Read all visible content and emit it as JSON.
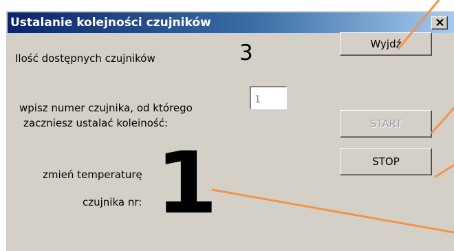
{
  "window": {
    "title": "Ustalanie kolejności czujników",
    "close_symbol": "×"
  },
  "info": {
    "available_label": "Ilość dostępnych czujników",
    "available_count": "3"
  },
  "start_sensor": {
    "label_line1": "wpisz numer czujnika, od którego",
    "label_line2": "zaczniesz ustalać koleiność:",
    "input_value": "1"
  },
  "change_temp": {
    "label_line1": "zmień temperaturę",
    "label_line2": "czujnika nr:",
    "current_sensor": "1"
  },
  "buttons": {
    "exit_label": "Wyjdź",
    "start_label": "START",
    "stop_label": "STOP"
  },
  "annotation_color": "#f4924a"
}
